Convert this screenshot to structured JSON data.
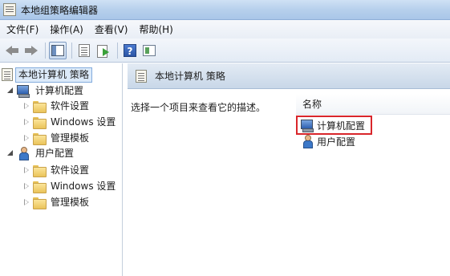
{
  "window": {
    "title": "本地组策略编辑器"
  },
  "menu": [
    "文件(F)",
    "操作(A)",
    "查看(V)",
    "帮助(H)"
  ],
  "toolbar": {
    "buttons": [
      "back-icon",
      "forward-icon",
      "show-hide-tree-icon",
      "properties-icon",
      "export-list-icon",
      "help-icon",
      "filter-icon"
    ]
  },
  "tree": {
    "root": "本地计算机 策略",
    "computer_config": {
      "label": "计算机配置",
      "children": [
        "软件设置",
        "Windows 设置",
        "管理模板"
      ]
    },
    "user_config": {
      "label": "用户配置",
      "children": [
        "软件设置",
        "Windows 设置",
        "管理模板"
      ]
    }
  },
  "right": {
    "header": "本地计算机 策略",
    "description": "选择一个项目来查看它的描述。",
    "column_name": "名称",
    "items": [
      "计算机配置",
      "用户配置"
    ]
  },
  "colors": {
    "highlight_box": "#d9262b",
    "selection": "#dceaf9"
  }
}
